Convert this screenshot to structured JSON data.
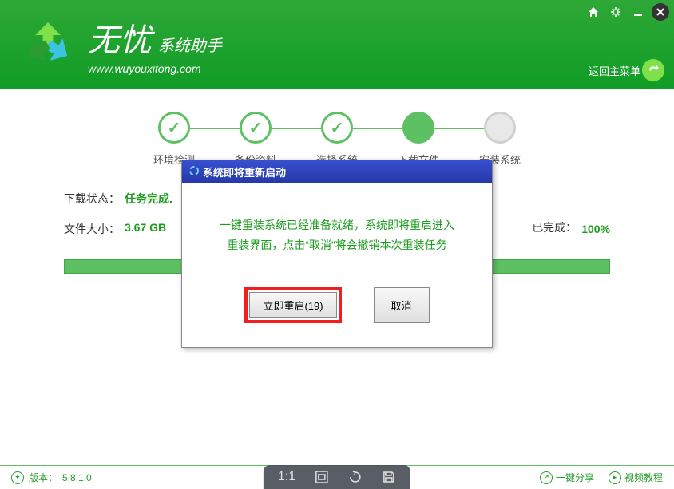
{
  "header": {
    "logo_main": "无忧",
    "logo_sub": "系统助手",
    "logo_url": "www.wuyouxitong.com",
    "return_label": "返回主菜单"
  },
  "steps": [
    {
      "label": "环境检测",
      "state": "done"
    },
    {
      "label": "备份资料",
      "state": "done"
    },
    {
      "label": "选择系统",
      "state": "done"
    },
    {
      "label": "下载文件",
      "state": "active"
    },
    {
      "label": "安装系统",
      "state": "pending"
    }
  ],
  "info": {
    "download_status_label": "下载状态：",
    "download_status_value": "任务完成.",
    "file_size_label": "文件大小：",
    "file_size_value": "3.67 GB",
    "complete_label": "已完成：",
    "complete_value": "100%"
  },
  "dialog": {
    "title": "系统即将重新启动",
    "message_line1": "一键重装系统已经准备就绪，系统即将重启进入",
    "message_line2": "重装界面，点击“取消”将会撤销本次重装任务",
    "restart_btn": "立即重启(19)",
    "cancel_btn": "取消"
  },
  "footer": {
    "version_label": "版本：",
    "version_value": "5.8.1.0",
    "share_label": "一键分享",
    "tutorial_label": "视频教程"
  },
  "view_toolbar": {
    "ratio": "1:1"
  }
}
